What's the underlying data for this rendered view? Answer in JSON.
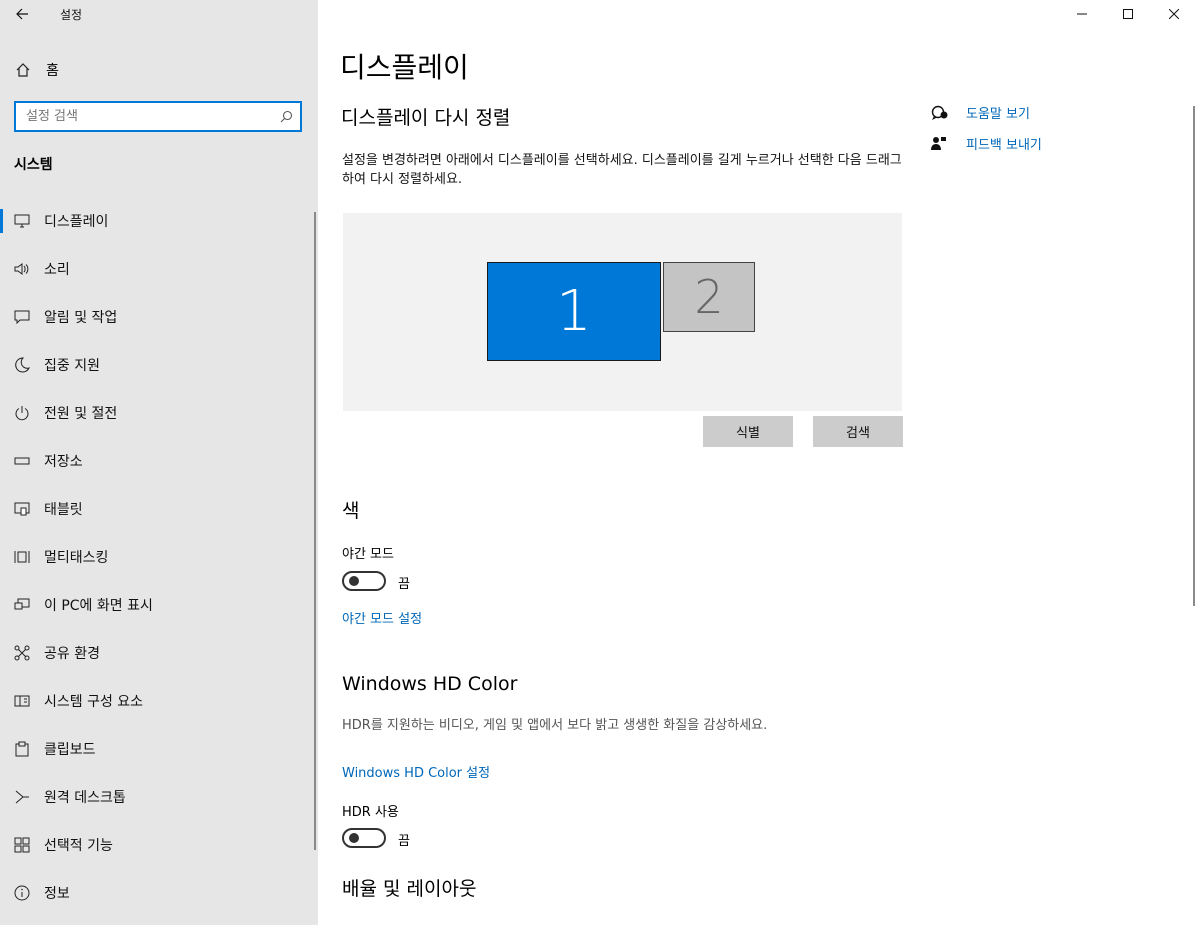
{
  "window": {
    "title": "설정",
    "controls": [
      "minimize-icon",
      "maximize-icon",
      "close-icon"
    ]
  },
  "sidebar": {
    "home_label": "홈",
    "search": {
      "placeholder": "설정 검색",
      "value": ""
    },
    "section_title": "시스템",
    "items": [
      {
        "label": "디스플레이",
        "icon": "display-icon",
        "active": true
      },
      {
        "label": "소리",
        "icon": "sound-icon"
      },
      {
        "label": "알림 및 작업",
        "icon": "notifications-icon"
      },
      {
        "label": "집중 지원",
        "icon": "focus-assist-icon"
      },
      {
        "label": "전원 및 절전",
        "icon": "power-icon"
      },
      {
        "label": "저장소",
        "icon": "storage-icon"
      },
      {
        "label": "태블릿",
        "icon": "tablet-icon"
      },
      {
        "label": "멀티태스킹",
        "icon": "multitasking-icon"
      },
      {
        "label": "이 PC에 화면 표시",
        "icon": "project-icon"
      },
      {
        "label": "공유 환경",
        "icon": "shared-experiences-icon"
      },
      {
        "label": "시스템 구성 요소",
        "icon": "system-components-icon"
      },
      {
        "label": "클립보드",
        "icon": "clipboard-icon"
      },
      {
        "label": "원격 데스크톱",
        "icon": "remote-desktop-icon"
      },
      {
        "label": "선택적 기능",
        "icon": "optional-features-icon"
      },
      {
        "label": "정보",
        "icon": "info-icon"
      }
    ]
  },
  "main": {
    "title": "디스플레이",
    "rearrange": {
      "heading": "디스플레이 다시 정렬",
      "description": "설정을 변경하려면 아래에서 디스플레이를 선택하세요. 디스플레이를 길게 누르거나 선택한 다음 드래그하여 다시 정렬하세요.",
      "monitors": [
        "1",
        "2"
      ],
      "identify_label": "식별",
      "detect_label": "검색"
    },
    "color": {
      "heading": "색",
      "night_light_label": "야간 모드",
      "night_light_state": "끔",
      "night_light_link": "야간 모드 설정"
    },
    "hd_color": {
      "heading": "Windows HD Color",
      "description": "HDR를 지원하는 비디오, 게임 및 앱에서 보다 밝고 생생한 화질을 감상하세요.",
      "link": "Windows HD Color 설정",
      "hdr_label": "HDR 사용",
      "hdr_state": "끔"
    },
    "scale": {
      "heading": "배율 및 레이아웃"
    }
  },
  "aside": {
    "help_label": "도움말 보기",
    "feedback_label": "피드백 보내기"
  },
  "colors": {
    "accent": "#0078d7",
    "link": "#0067b8",
    "sidebar_bg": "#e6e6e6"
  }
}
